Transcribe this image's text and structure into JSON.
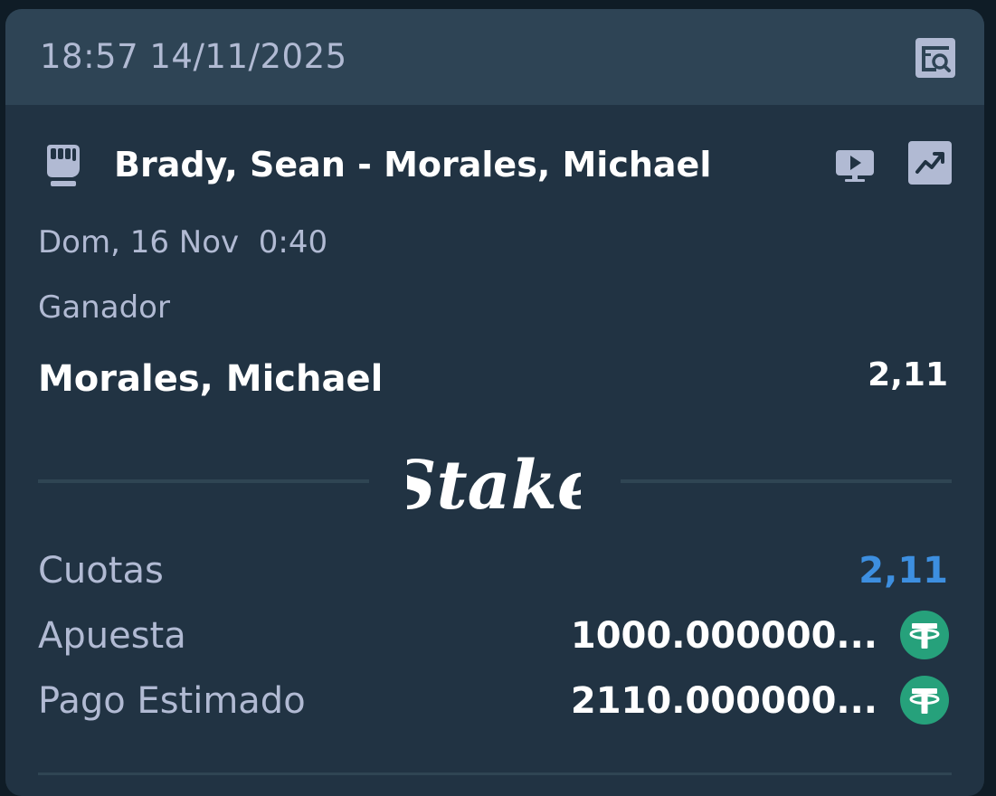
{
  "header": {
    "timestamp": "18:57 14/11/2025",
    "receipt_icon": "receipt-search-icon"
  },
  "event": {
    "sport_icon": "mma-glove-icon",
    "title": "Brady, Sean - Morales, Michael",
    "stream_icon": "live-stream-icon",
    "stats_icon": "stats-chart-icon",
    "date": "Dom, 16 Nov  0:40"
  },
  "bet": {
    "market": "Ganador",
    "selection": "Morales, Michael",
    "odds": "2,11"
  },
  "brand": {
    "logo_text": "Stake"
  },
  "summary": {
    "odds_label": "Cuotas",
    "odds_value": "2,11",
    "stake_label": "Apuesta",
    "stake_value": "1000.000000...",
    "payout_label": "Pago Estimado",
    "payout_value": "2110.000000...",
    "currency_icon": "usdt-tether-icon"
  },
  "colors": {
    "background": "#0f1c26",
    "card": "#213343",
    "header": "#2e4455",
    "muted_text": "#b1bad3",
    "odds_blue": "#3d8fe0",
    "tether_green": "#26a17b"
  }
}
